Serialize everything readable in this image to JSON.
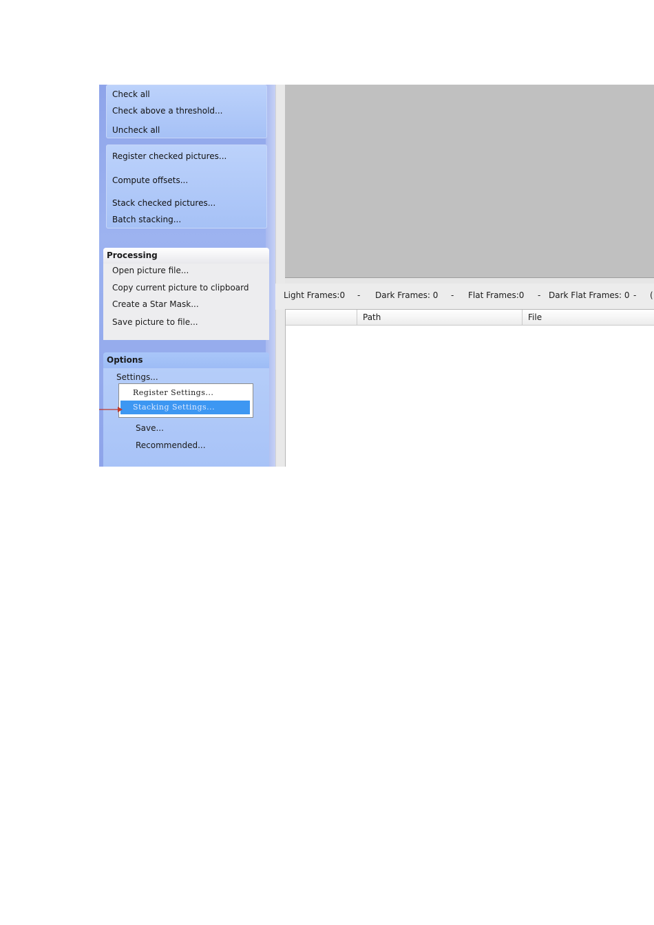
{
  "actions_group_1": {
    "items": [
      "Check all",
      "Check above a threshold...",
      "Uncheck all"
    ]
  },
  "actions_group_2": {
    "items": [
      "Register checked pictures...",
      "Compute offsets...",
      "Stack checked pictures...",
      "Batch stacking..."
    ]
  },
  "processing": {
    "title": "Processing",
    "items": [
      "Open picture file...",
      "Copy current picture to clipboard",
      "Create a Star Mask...",
      "Save picture to file..."
    ]
  },
  "options": {
    "title": "Options",
    "settings_label": "Settings...",
    "save_label": "Save...",
    "recommended_label": "Recommended...",
    "settings_menu": {
      "items": [
        "Register Settings...",
        "Stacking Settings..."
      ],
      "selected": "Stacking Settings..."
    }
  },
  "status_bar": {
    "light": "Light Frames:0",
    "dark": "Dark Frames: 0",
    "flat": "Flat Frames:0",
    "dark_flat": "Dark Flat Frames: 0",
    "separator": "-",
    "trailing": "("
  },
  "file_list": {
    "columns": [
      "",
      "Path",
      "File"
    ]
  },
  "colors": {
    "pane_blue": "#9db3f0",
    "selection_blue": "#3d97f2",
    "arrow_red": "#c0392b",
    "preview_gray": "#c0c0c0"
  }
}
